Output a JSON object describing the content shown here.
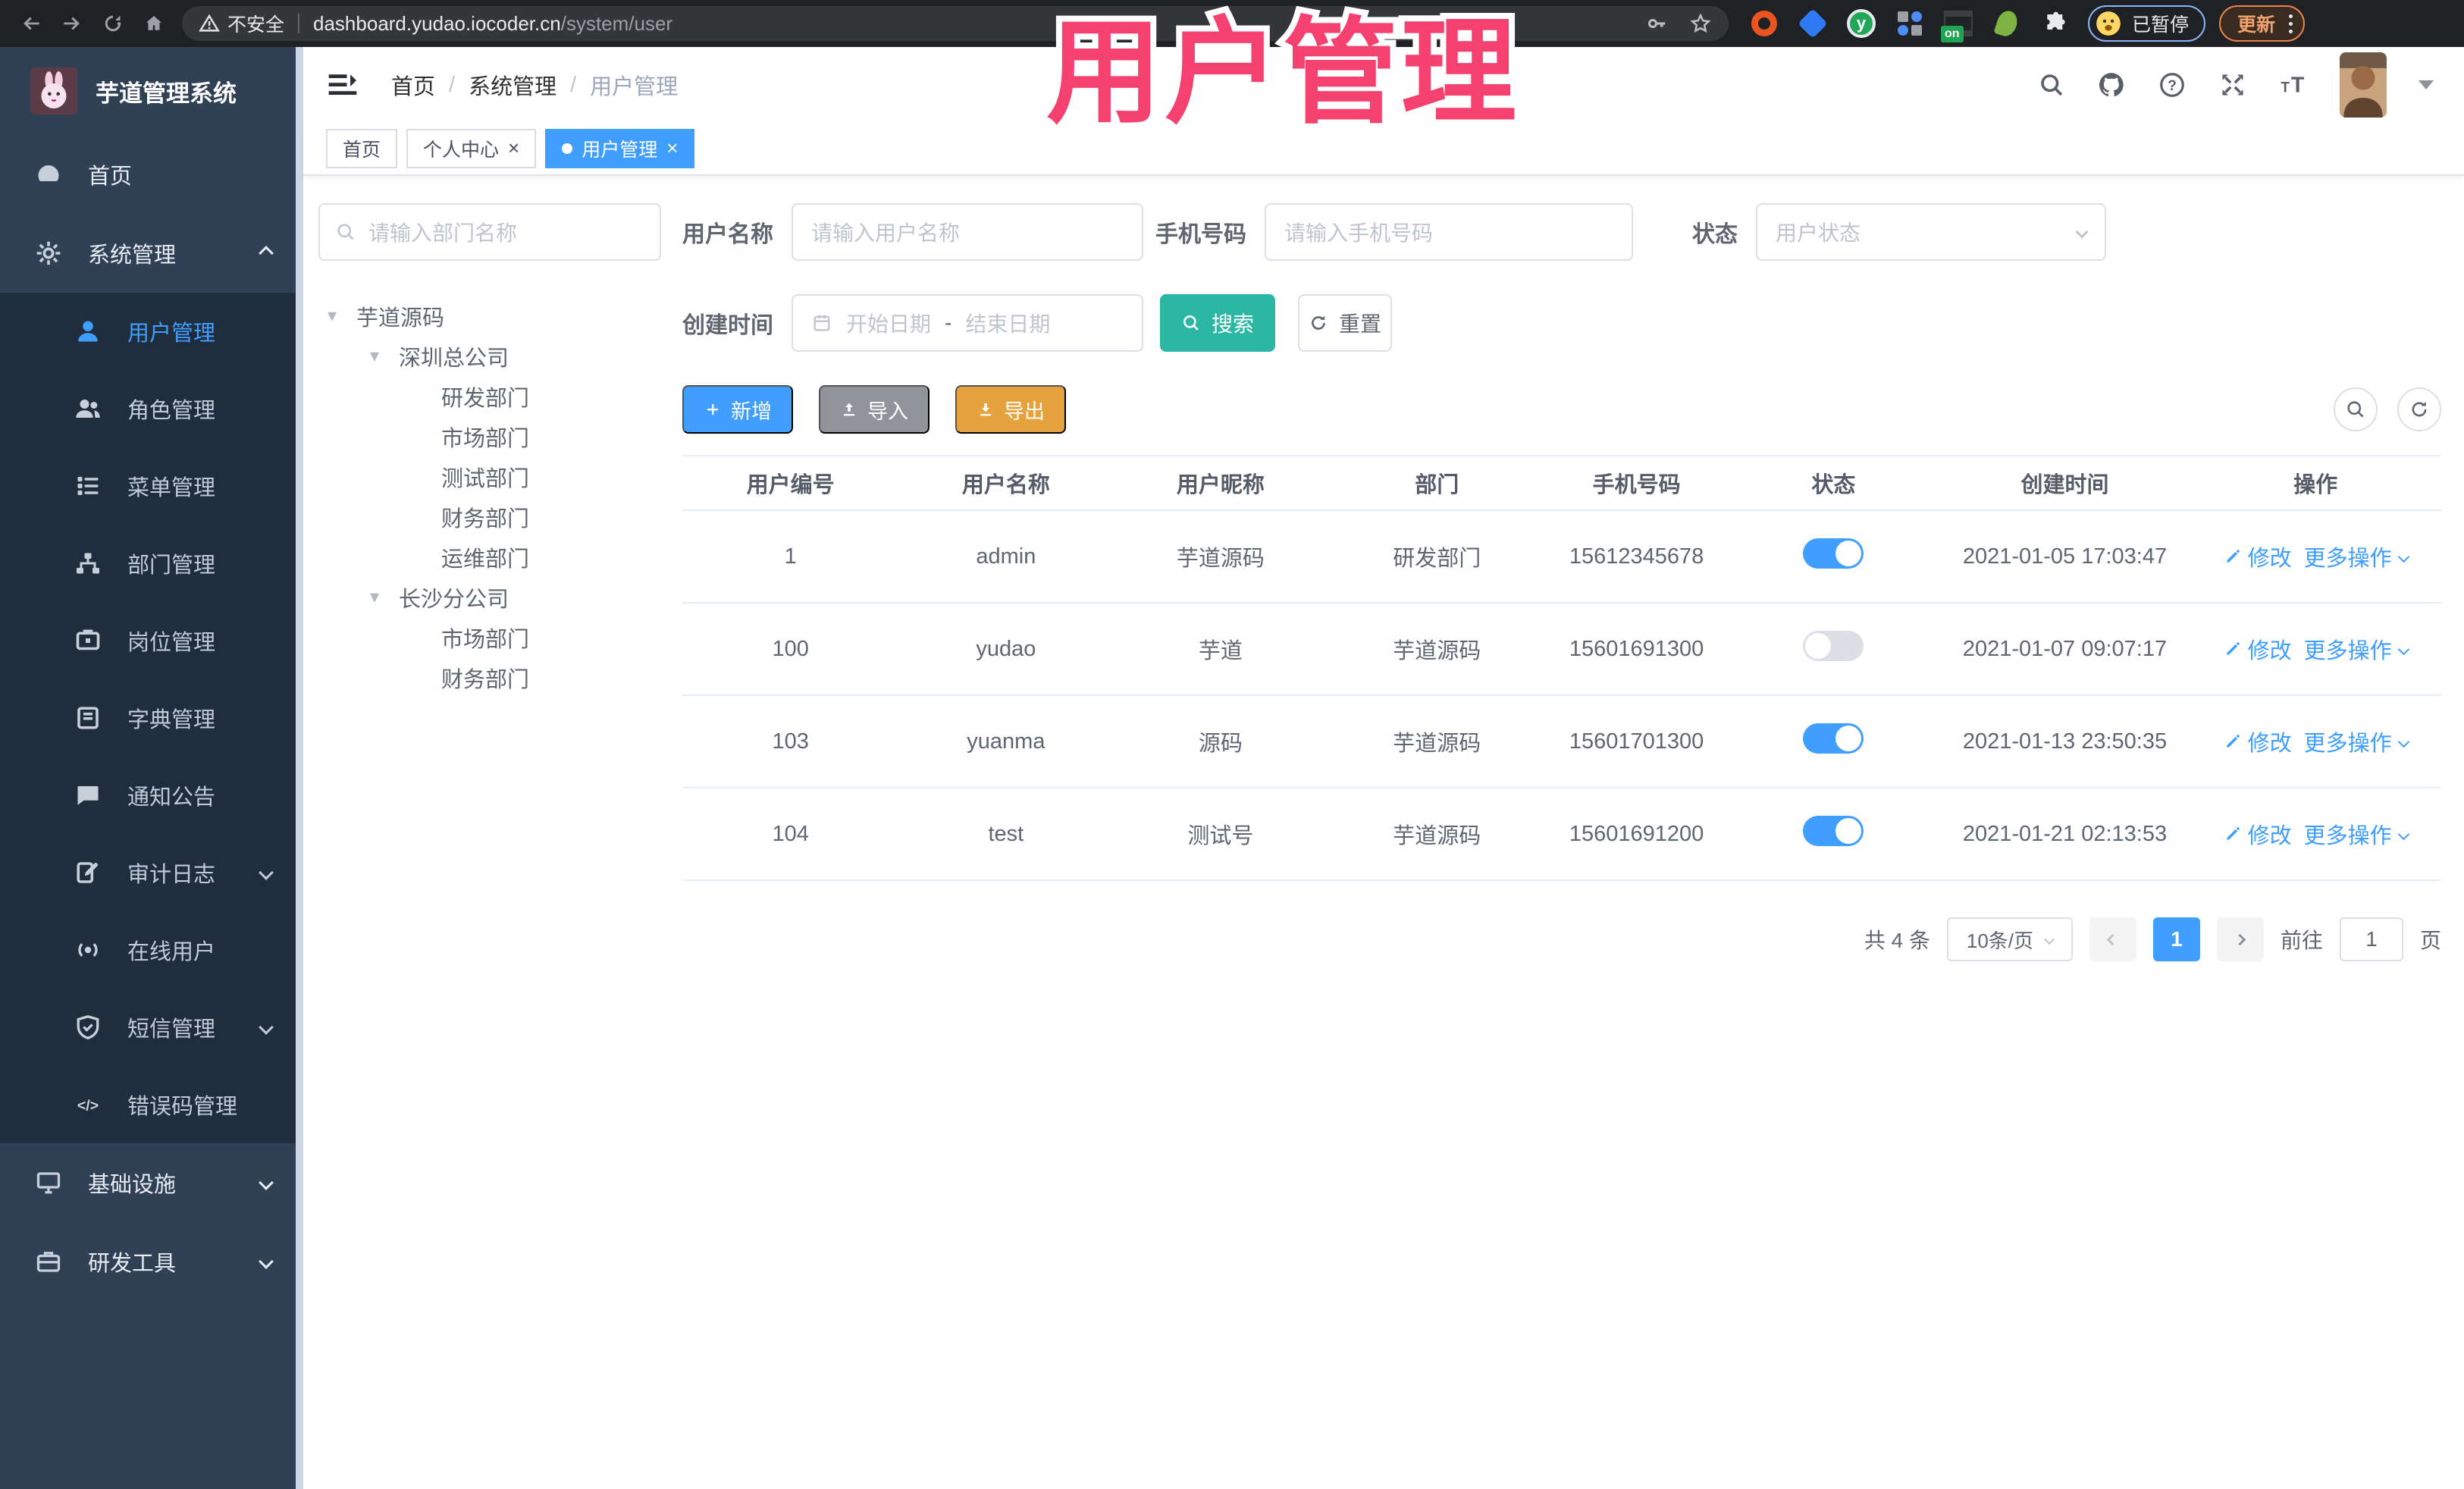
{
  "colors": {
    "accent": "#409EFF",
    "teal": "#2CB6A4",
    "warning": "#E6A23C",
    "info": "#909399",
    "sidebar_bg": "#304156",
    "submenu_bg": "#1f2d3d",
    "annotation": "#f4416f"
  },
  "annotation": {
    "text": "用户管理"
  },
  "browser": {
    "security_label": "不安全",
    "url_host": "dashboard.yudao.iocoder.cn",
    "url_path": "/system/user",
    "ext_on_badge": "on",
    "ext_y_label": "y",
    "profile_label": "已暂停",
    "update_label": "更新"
  },
  "sidebar": {
    "logo_title": "芋道管理系统",
    "menu": [
      {
        "key": "home",
        "label": "首页",
        "icon": "dashboard",
        "type": "top"
      },
      {
        "key": "system",
        "label": "系统管理",
        "icon": "gear",
        "type": "top",
        "arrow": "up"
      },
      {
        "key": "user",
        "label": "用户管理",
        "icon": "user",
        "type": "sub",
        "active": true
      },
      {
        "key": "role",
        "label": "角色管理",
        "icon": "users",
        "type": "sub"
      },
      {
        "key": "menu",
        "label": "菜单管理",
        "icon": "list",
        "type": "sub"
      },
      {
        "key": "dept",
        "label": "部门管理",
        "icon": "tree",
        "type": "sub"
      },
      {
        "key": "post",
        "label": "岗位管理",
        "icon": "badge",
        "type": "sub"
      },
      {
        "key": "dict",
        "label": "字典管理",
        "icon": "book",
        "type": "sub"
      },
      {
        "key": "notice",
        "label": "通知公告",
        "icon": "message",
        "type": "sub"
      },
      {
        "key": "audit",
        "label": "审计日志",
        "icon": "log",
        "type": "sub",
        "arrow": "down"
      },
      {
        "key": "online",
        "label": "在线用户",
        "icon": "online",
        "type": "sub"
      },
      {
        "key": "sms",
        "label": "短信管理",
        "icon": "shield",
        "type": "sub",
        "arrow": "down"
      },
      {
        "key": "errcode",
        "label": "错误码管理",
        "icon": "code",
        "type": "sub"
      },
      {
        "key": "infra",
        "label": "基础设施",
        "icon": "monitor",
        "type": "top",
        "arrow": "down"
      },
      {
        "key": "tool",
        "label": "研发工具",
        "icon": "briefcase",
        "type": "top",
        "arrow": "down"
      }
    ]
  },
  "navbar": {
    "breadcrumb": [
      "首页",
      "系统管理",
      "用户管理"
    ]
  },
  "tabs": [
    {
      "label": "首页",
      "closable": false,
      "active": false
    },
    {
      "label": "个人中心",
      "closable": true,
      "active": false
    },
    {
      "label": "用户管理",
      "closable": true,
      "active": true
    }
  ],
  "dept_panel": {
    "search_placeholder": "请输入部门名称",
    "tree": [
      {
        "label": "芋道源码",
        "level": 0,
        "caret": true
      },
      {
        "label": "深圳总公司",
        "level": 1,
        "caret": true
      },
      {
        "label": "研发部门",
        "level": 2,
        "caret": false
      },
      {
        "label": "市场部门",
        "level": 2,
        "caret": false
      },
      {
        "label": "测试部门",
        "level": 2,
        "caret": false
      },
      {
        "label": "财务部门",
        "level": 2,
        "caret": false
      },
      {
        "label": "运维部门",
        "level": 2,
        "caret": false
      },
      {
        "label": "长沙分公司",
        "level": 1,
        "caret": true
      },
      {
        "label": "市场部门",
        "level": 2,
        "caret": false
      },
      {
        "label": "财务部门",
        "level": 2,
        "caret": false
      }
    ]
  },
  "filters": {
    "username_label": "用户名称",
    "username_placeholder": "请输入用户名称",
    "mobile_label": "手机号码",
    "mobile_placeholder": "请输入手机号码",
    "status_label": "状态",
    "status_placeholder": "用户状态",
    "create_time_label": "创建时间",
    "date_start_placeholder": "开始日期",
    "date_separator": "-",
    "date_end_placeholder": "结束日期",
    "search_button": "搜索",
    "reset_button": "重置"
  },
  "toolbar": {
    "add": "新增",
    "import": "导入",
    "export": "导出"
  },
  "table": {
    "columns": [
      "用户编号",
      "用户名称",
      "用户昵称",
      "部门",
      "手机号码",
      "状态",
      "创建时间",
      "操作"
    ],
    "col_widths": [
      12.3,
      12.2,
      12.2,
      12.4,
      10.3,
      12.1,
      14.2,
      14.3
    ],
    "actions": {
      "edit": "修改",
      "more": "更多操作"
    },
    "rows": [
      {
        "id": "1",
        "username": "admin",
        "nickname": "芋道源码",
        "dept": "研发部门",
        "mobile": "15612345678",
        "status": true,
        "created": "2021-01-05 17:03:47"
      },
      {
        "id": "100",
        "username": "yudao",
        "nickname": "芋道",
        "dept": "芋道源码",
        "mobile": "15601691300",
        "status": false,
        "created": "2021-01-07 09:07:17"
      },
      {
        "id": "103",
        "username": "yuanma",
        "nickname": "源码",
        "dept": "芋道源码",
        "mobile": "15601701300",
        "status": true,
        "created": "2021-01-13 23:50:35"
      },
      {
        "id": "104",
        "username": "test",
        "nickname": "测试号",
        "dept": "芋道源码",
        "mobile": "15601691200",
        "status": true,
        "created": "2021-01-21 02:13:53"
      }
    ]
  },
  "pagination": {
    "total": "共 4 条",
    "page_size": "10条/页",
    "current_page": "1",
    "goto_label": "前往",
    "goto_value": "1",
    "page_suffix": "页"
  }
}
